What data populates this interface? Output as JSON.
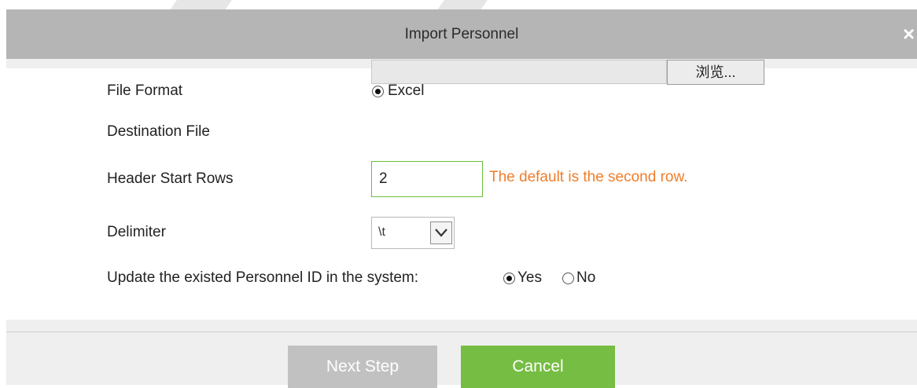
{
  "dialog": {
    "title": "Import Personnel",
    "close_glyph": "×"
  },
  "form": {
    "file_format": {
      "label": "File Format",
      "option_label": "Excel",
      "selected": true
    },
    "destination_file": {
      "label": "Destination File",
      "value": "",
      "browse_label": "浏览..."
    },
    "header_start_rows": {
      "label": "Header Start Rows",
      "value": "2",
      "hint": "The default is the second row."
    },
    "delimiter": {
      "label": "Delimiter",
      "value": "\\t"
    },
    "update_existing": {
      "label": "Update the existed Personnel ID in the system:",
      "yes_label": "Yes",
      "no_label": "No",
      "selected": "Yes"
    }
  },
  "buttons": {
    "next_step": "Next Step",
    "cancel": "Cancel"
  },
  "colors": {
    "title_bar": "#b5b5b5",
    "dialog_bg": "#efefef",
    "hint_text": "#f07d2a",
    "input_focus_border": "#6bbf3a",
    "cancel_button": "#76bd43",
    "next_button_disabled": "#c1c1c1"
  },
  "icons": {
    "close": "close-icon",
    "dropdown": "chevron-down-icon"
  }
}
